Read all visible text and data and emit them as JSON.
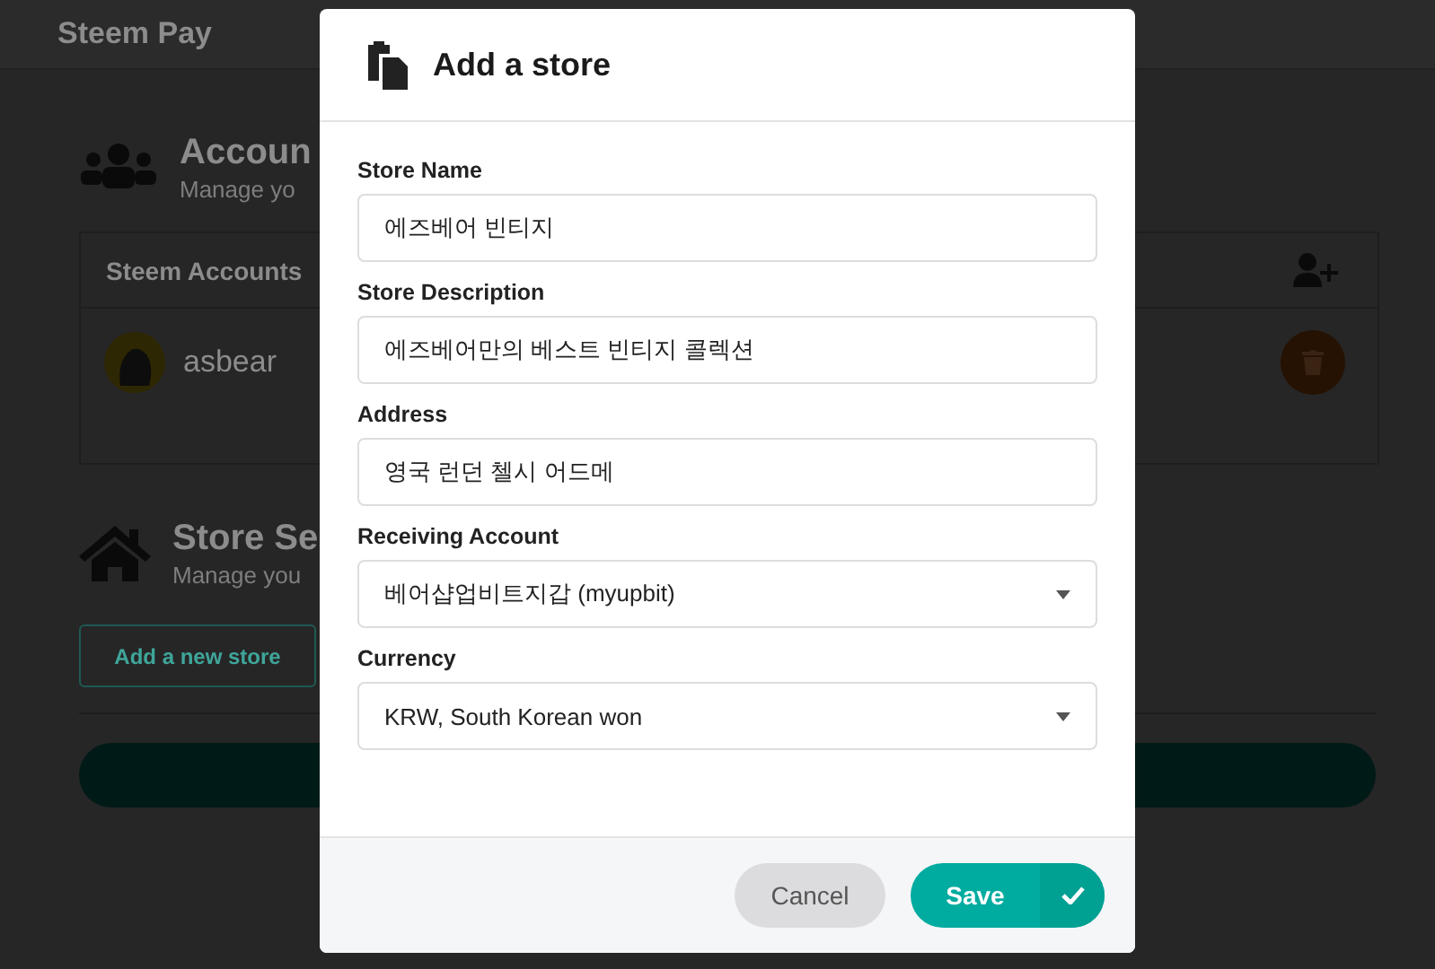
{
  "app": {
    "title": "Steem Pay"
  },
  "accounts_section": {
    "title": "Accoun",
    "subtitle": "Manage yo",
    "table": {
      "column_1": "Steem Accounts",
      "rows": [
        {
          "name": "asbear"
        }
      ]
    }
  },
  "store_section": {
    "title": "Store Se",
    "subtitle": "Manage you",
    "add_button": "Add a new store"
  },
  "dialog": {
    "title": "Add a store",
    "fields": [
      {
        "kind": "text",
        "label": "Store Name",
        "value": "에즈베어 빈티지"
      },
      {
        "kind": "text",
        "label": "Store Description",
        "value": "에즈베어만의 베스트 빈티지 콜렉션"
      },
      {
        "kind": "text",
        "label": "Address",
        "value": "영국 런던 첼시 어드메"
      },
      {
        "kind": "select",
        "label": "Receiving Account",
        "value": "베어샵업비트지갑 (myupbit)"
      },
      {
        "kind": "select",
        "label": "Currency",
        "value": "KRW, South Korean won"
      }
    ],
    "buttons": [
      {
        "kind": "secondary",
        "label": "Cancel"
      },
      {
        "kind": "primary",
        "label": "Save"
      }
    ]
  }
}
